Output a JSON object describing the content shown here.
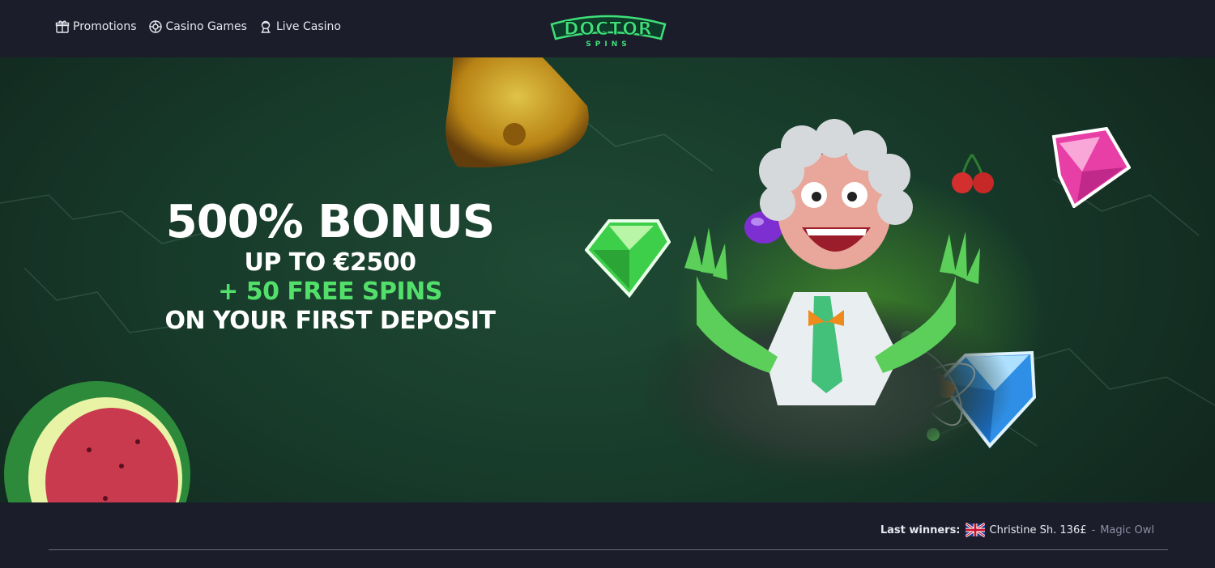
{
  "nav": {
    "items": [
      {
        "label": "Promotions",
        "icon": "gift-icon"
      },
      {
        "label": "Casino Games",
        "icon": "chip-icon"
      },
      {
        "label": "Live Casino",
        "icon": "dealer-icon"
      }
    ]
  },
  "logo": {
    "top": "DOCTOR",
    "bottom": "SPINS"
  },
  "hero": {
    "headline": "500% BONUS",
    "line1": "UP TO €2500",
    "line2": "+ 50 FREE SPINS",
    "line3": "ON YOUR FIRST DEPOSIT"
  },
  "winners": {
    "label": "Last winners:",
    "name_amount": "Christine Sh. 136£",
    "separator": "-",
    "game": "Magic Owl",
    "flag": "uk-flag-icon"
  },
  "colors": {
    "background": "#1c1d2b",
    "accent_green": "#52e06a",
    "hero_green": "#1f4a34"
  }
}
